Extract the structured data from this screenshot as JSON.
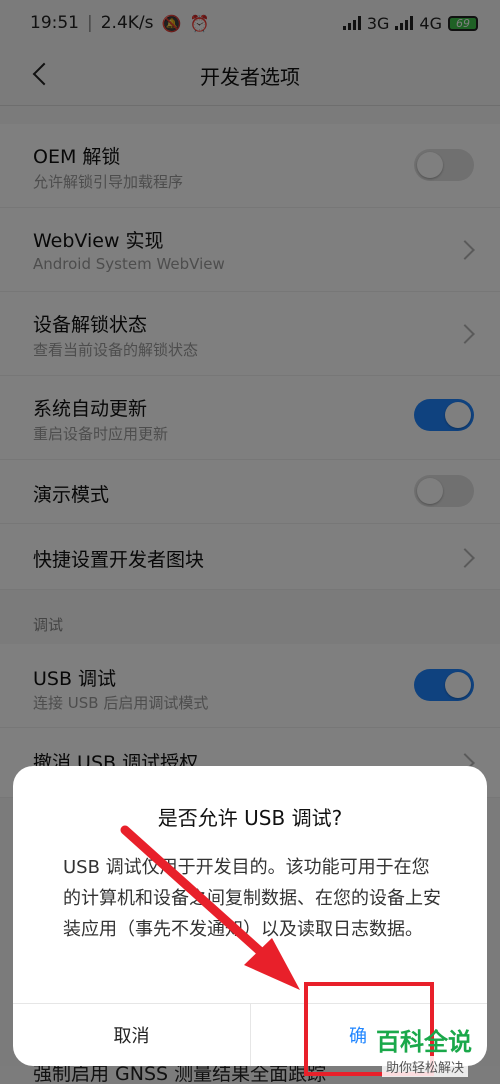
{
  "status_bar": {
    "time": "19:51",
    "speed": "2.4K/s",
    "net1": "3G",
    "net2": "4G",
    "battery": "69"
  },
  "header": {
    "title": "开发者选项"
  },
  "settings": {
    "oem": {
      "title": "OEM 解锁",
      "subtitle": "允许解锁引导加载程序",
      "enabled": false
    },
    "webview": {
      "title": "WebView 实现",
      "subtitle": "Android System WebView"
    },
    "unlock_state": {
      "title": "设备解锁状态",
      "subtitle": "查看当前设备的解锁状态"
    },
    "auto_update": {
      "title": "系统自动更新",
      "subtitle": "重启设备时应用更新",
      "enabled": true
    },
    "demo": {
      "title": "演示模式",
      "enabled": false
    },
    "quick_tiles": {
      "title": "快捷设置开发者图块"
    },
    "debug_section": "调试",
    "usb_debug": {
      "title": "USB 调试",
      "subtitle": "连接 USB 后启用调试模式",
      "enabled": true
    },
    "revoke": {
      "title": "撤消 USB 调试授权"
    },
    "gnss": {
      "title": "强制启用 GNSS 测量结果全面跟踪"
    }
  },
  "dialog": {
    "title": "是否允许 USB 调试?",
    "body": "USB 调试仅用于开发目的。该功能可用于在您的计算机和设备之间复制数据、在您的设备上安装应用（事先不发通知）以及读取日志数据。",
    "cancel": "取消",
    "ok": "确"
  },
  "watermark": {
    "title": "百科全说",
    "tagline": "助你轻松解决"
  },
  "colors": {
    "accent": "#1f85ff",
    "annotation_red": "#e8202a",
    "watermark_green": "#1aa84a"
  }
}
